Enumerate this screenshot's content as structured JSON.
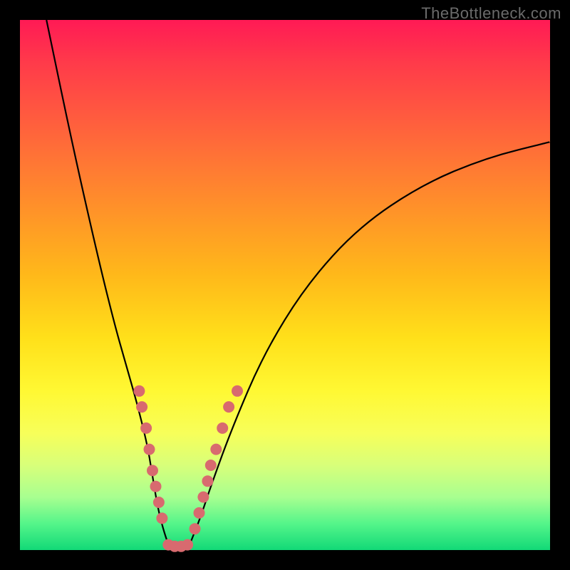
{
  "watermark": "TheBottleneck.com",
  "colors": {
    "background": "#000000",
    "gradient_top": "#ff1a55",
    "gradient_bottom": "#12d977",
    "curve": "#000000",
    "dot": "#d86a6f"
  },
  "chart_data": {
    "type": "line",
    "title": "",
    "xlabel": "",
    "ylabel": "",
    "xlim": [
      0,
      100
    ],
    "ylim": [
      0,
      100
    ],
    "grid": false,
    "legend": false,
    "annotations": [],
    "series": [
      {
        "name": "left-branch",
        "x": [
          5,
          10,
          15,
          18,
          20,
          22,
          24,
          25,
          26,
          27,
          28
        ],
        "y": [
          100,
          76,
          54,
          42,
          35,
          28,
          20,
          14,
          8,
          4,
          1
        ]
      },
      {
        "name": "valley-floor",
        "x": [
          28,
          30,
          32
        ],
        "y": [
          1,
          0.5,
          1
        ]
      },
      {
        "name": "right-branch",
        "x": [
          32,
          34,
          36,
          40,
          46,
          54,
          64,
          76,
          88,
          100
        ],
        "y": [
          1,
          6,
          12,
          23,
          37,
          50,
          61,
          69,
          74,
          77
        ]
      }
    ],
    "markers": [
      {
        "branch": "left",
        "x": 22.5,
        "y": 30
      },
      {
        "branch": "left",
        "x": 23.0,
        "y": 27
      },
      {
        "branch": "left",
        "x": 23.8,
        "y": 23
      },
      {
        "branch": "left",
        "x": 24.4,
        "y": 19
      },
      {
        "branch": "left",
        "x": 25.0,
        "y": 15
      },
      {
        "branch": "left",
        "x": 25.6,
        "y": 12
      },
      {
        "branch": "left",
        "x": 26.2,
        "y": 9
      },
      {
        "branch": "left",
        "x": 26.8,
        "y": 6
      },
      {
        "branch": "floor",
        "x": 28.0,
        "y": 1
      },
      {
        "branch": "floor",
        "x": 29.2,
        "y": 0.7
      },
      {
        "branch": "floor",
        "x": 30.4,
        "y": 0.7
      },
      {
        "branch": "floor",
        "x": 31.6,
        "y": 1
      },
      {
        "branch": "right",
        "x": 33.0,
        "y": 4
      },
      {
        "branch": "right",
        "x": 33.8,
        "y": 7
      },
      {
        "branch": "right",
        "x": 34.6,
        "y": 10
      },
      {
        "branch": "right",
        "x": 35.4,
        "y": 13
      },
      {
        "branch": "right",
        "x": 36.0,
        "y": 16
      },
      {
        "branch": "right",
        "x": 37.0,
        "y": 19
      },
      {
        "branch": "right",
        "x": 38.2,
        "y": 23
      },
      {
        "branch": "right",
        "x": 39.4,
        "y": 27
      },
      {
        "branch": "right",
        "x": 41.0,
        "y": 30
      }
    ]
  }
}
